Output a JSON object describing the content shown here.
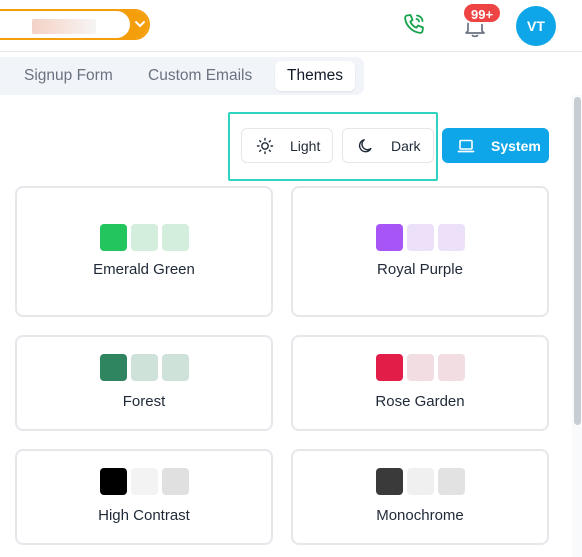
{
  "header": {
    "notifications_badge": "99+",
    "avatar_initials": "VT"
  },
  "tabs": [
    {
      "label": "Signup Form",
      "active": false
    },
    {
      "label": "Custom Emails",
      "active": false
    },
    {
      "label": "Themes",
      "active": true
    }
  ],
  "mode": {
    "light_label": "Light",
    "dark_label": "Dark",
    "system_label": "System",
    "selected": "System"
  },
  "colors": {
    "accent": "#0ea5e9",
    "highlight": "#2dd4bf",
    "org_border": "#f59e0b",
    "phone_green": "#16a34a",
    "badge_red": "#ef4444"
  },
  "themes": [
    {
      "name": "Emerald Green",
      "swatches": [
        "#22c55e",
        "#d4eedd",
        "#d4eedd"
      ]
    },
    {
      "name": "Royal Purple",
      "swatches": [
        "#a855f7",
        "#ece1f8",
        "#ece1f8"
      ]
    },
    {
      "name": "Forest",
      "swatches": [
        "#2e8560",
        "#cfe2d9",
        "#cfe2d9"
      ]
    },
    {
      "name": "Rose Garden",
      "swatches": [
        "#e11d48",
        "#f2dde2",
        "#f2dde2"
      ]
    },
    {
      "name": "High Contrast",
      "swatches": [
        "#000000",
        "#f3f3f3",
        "#e0e0e0"
      ]
    },
    {
      "name": "Monochrome",
      "swatches": [
        "#3a3a3a",
        "#f0f0f0",
        "#e2e2e2"
      ]
    }
  ]
}
